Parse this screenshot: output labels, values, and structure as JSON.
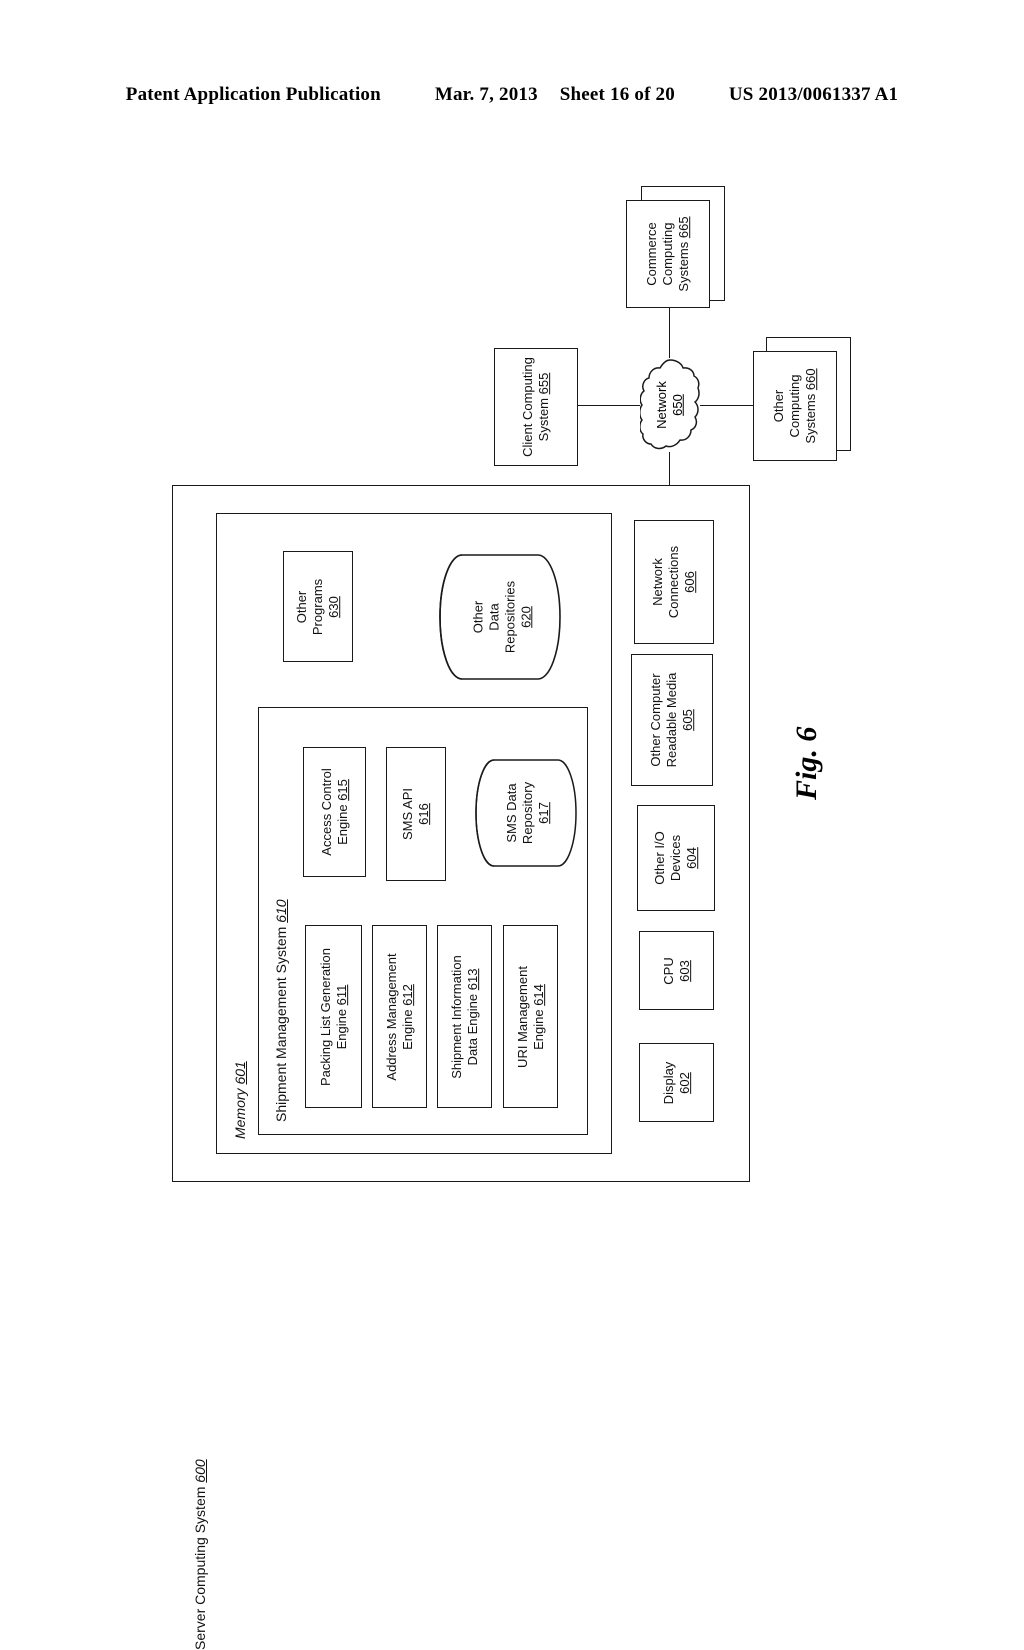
{
  "header": {
    "publication": "Patent Application Publication",
    "date": "Mar. 7, 2013",
    "sheet": "Sheet 16 of 20",
    "docnum": "US 2013/0061337 A1"
  },
  "figure": {
    "caption": "Fig. 6"
  },
  "diagram": {
    "server": {
      "title": "Server Computing System",
      "num": "600"
    },
    "memory": {
      "title": "Memory",
      "num": "601"
    },
    "sms": {
      "title": "Shipment Management System",
      "num": "610"
    },
    "engines": [
      {
        "line1": "Packing List Generation",
        "line2": "Engine",
        "num": "611"
      },
      {
        "line1": "Address Management",
        "line2": "Engine",
        "num": "612"
      },
      {
        "line1": "Shipment Information",
        "line2": "Data Engine",
        "num": "613"
      },
      {
        "line1": "URI Management",
        "line2": "Engine",
        "num": "614"
      }
    ],
    "modules": [
      {
        "line1": "Access Control",
        "line2": "Engine",
        "num": "615"
      },
      {
        "line1": "SMS API",
        "line2": "",
        "num": "616"
      }
    ],
    "sms_repository": {
      "line1": "SMS Data",
      "line2": "Repository",
      "num": "617"
    },
    "other_programs": {
      "line1": "Other",
      "line2": "Programs",
      "num": "630"
    },
    "other_data_repositories": {
      "line1": "Other",
      "line2": "Data",
      "line3": "Repositories",
      "num": "620"
    },
    "hardware": [
      {
        "line1": "Display",
        "line2": "",
        "num": "602"
      },
      {
        "line1": "CPU",
        "line2": "",
        "num": "603"
      },
      {
        "line1": "Other I/O",
        "line2": "Devices",
        "num": "604"
      },
      {
        "line1": "Other Computer",
        "line2": "Readable Media",
        "num": "605"
      },
      {
        "line1": "Network",
        "line2": "Connections",
        "num": "606"
      }
    ],
    "network": {
      "line1": "Network",
      "num": "650"
    },
    "client": {
      "line1": "Client Computing",
      "line2": "System",
      "num": "655"
    },
    "commerce": {
      "line1": "Commerce",
      "line2": "Computing",
      "line3": "Systems",
      "num": "665"
    },
    "other_systems": {
      "line1": "Other",
      "line2": "Computing",
      "line3": "Systems",
      "num": "660"
    }
  }
}
